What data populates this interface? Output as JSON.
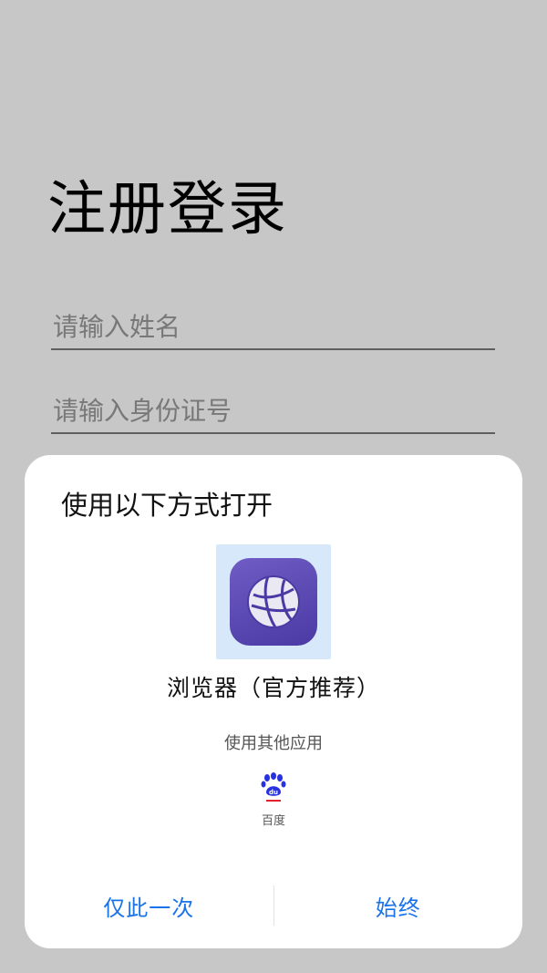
{
  "page": {
    "title": "注册登录",
    "name_field": {
      "placeholder": "请输入姓名",
      "value": ""
    },
    "id_field": {
      "placeholder": "请输入身份证号",
      "value": ""
    }
  },
  "dialog": {
    "title": "使用以下方式打开",
    "recommended_app": {
      "name": "浏览器（官方推荐）",
      "icon": "browser-globe-icon"
    },
    "other_apps_label": "使用其他应用",
    "other_apps": [
      {
        "name": "百度",
        "icon": "baidu-paw-icon"
      }
    ],
    "actions": {
      "once": "仅此一次",
      "always": "始终"
    }
  },
  "colors": {
    "accent": "#1a73e8",
    "browser_icon": "#5a48b5",
    "tile_highlight": "#d7e8fb",
    "baidu_blue": "#2932e1",
    "baidu_red": "#e1242c"
  }
}
